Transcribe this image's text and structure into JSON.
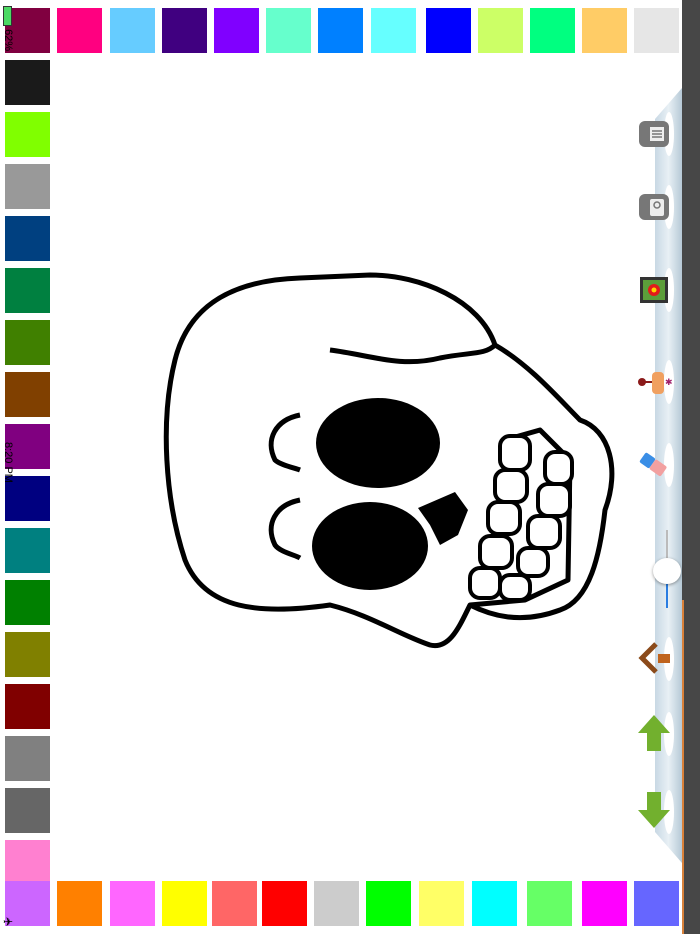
{
  "status_bar": {
    "battery": "62%",
    "time": "8:20 PM"
  },
  "palette": {
    "top": [
      "#800040",
      "#ff0080",
      "#66ccff",
      "#400080",
      "#8000ff",
      "#66ffcc",
      "#0080ff",
      "#66ffff",
      "#0000ff",
      "#ccff66",
      "#00ff80",
      "#ffcc66",
      "#e6e6e6"
    ],
    "left": [
      "#1a1a1a",
      "#80ff00",
      "#999999",
      "#004080",
      "#008040",
      "#408000",
      "#804000",
      "#800080",
      "#000080",
      "#008080",
      "#008000",
      "#808000",
      "#800000",
      "#808080",
      "#666666",
      "#ff80d0"
    ],
    "bottom": [
      "#cc66ff",
      "#ff8000",
      "#ff66ff",
      "#ffff00",
      "#ff6666",
      "#ff0000",
      "#cccccc",
      "#00ff00",
      "#ffff66",
      "#00ffff",
      "#66ff66",
      "#ff00ff",
      "#6666ff"
    ]
  },
  "toolbar": {
    "tools": [
      "menu-icon",
      "save-icon",
      "gallery-icon",
      "stamp-icon",
      "eraser-icon",
      "home-icon",
      "arrow-up-icon",
      "arrow-down-icon"
    ],
    "brush_size": 0.42
  }
}
